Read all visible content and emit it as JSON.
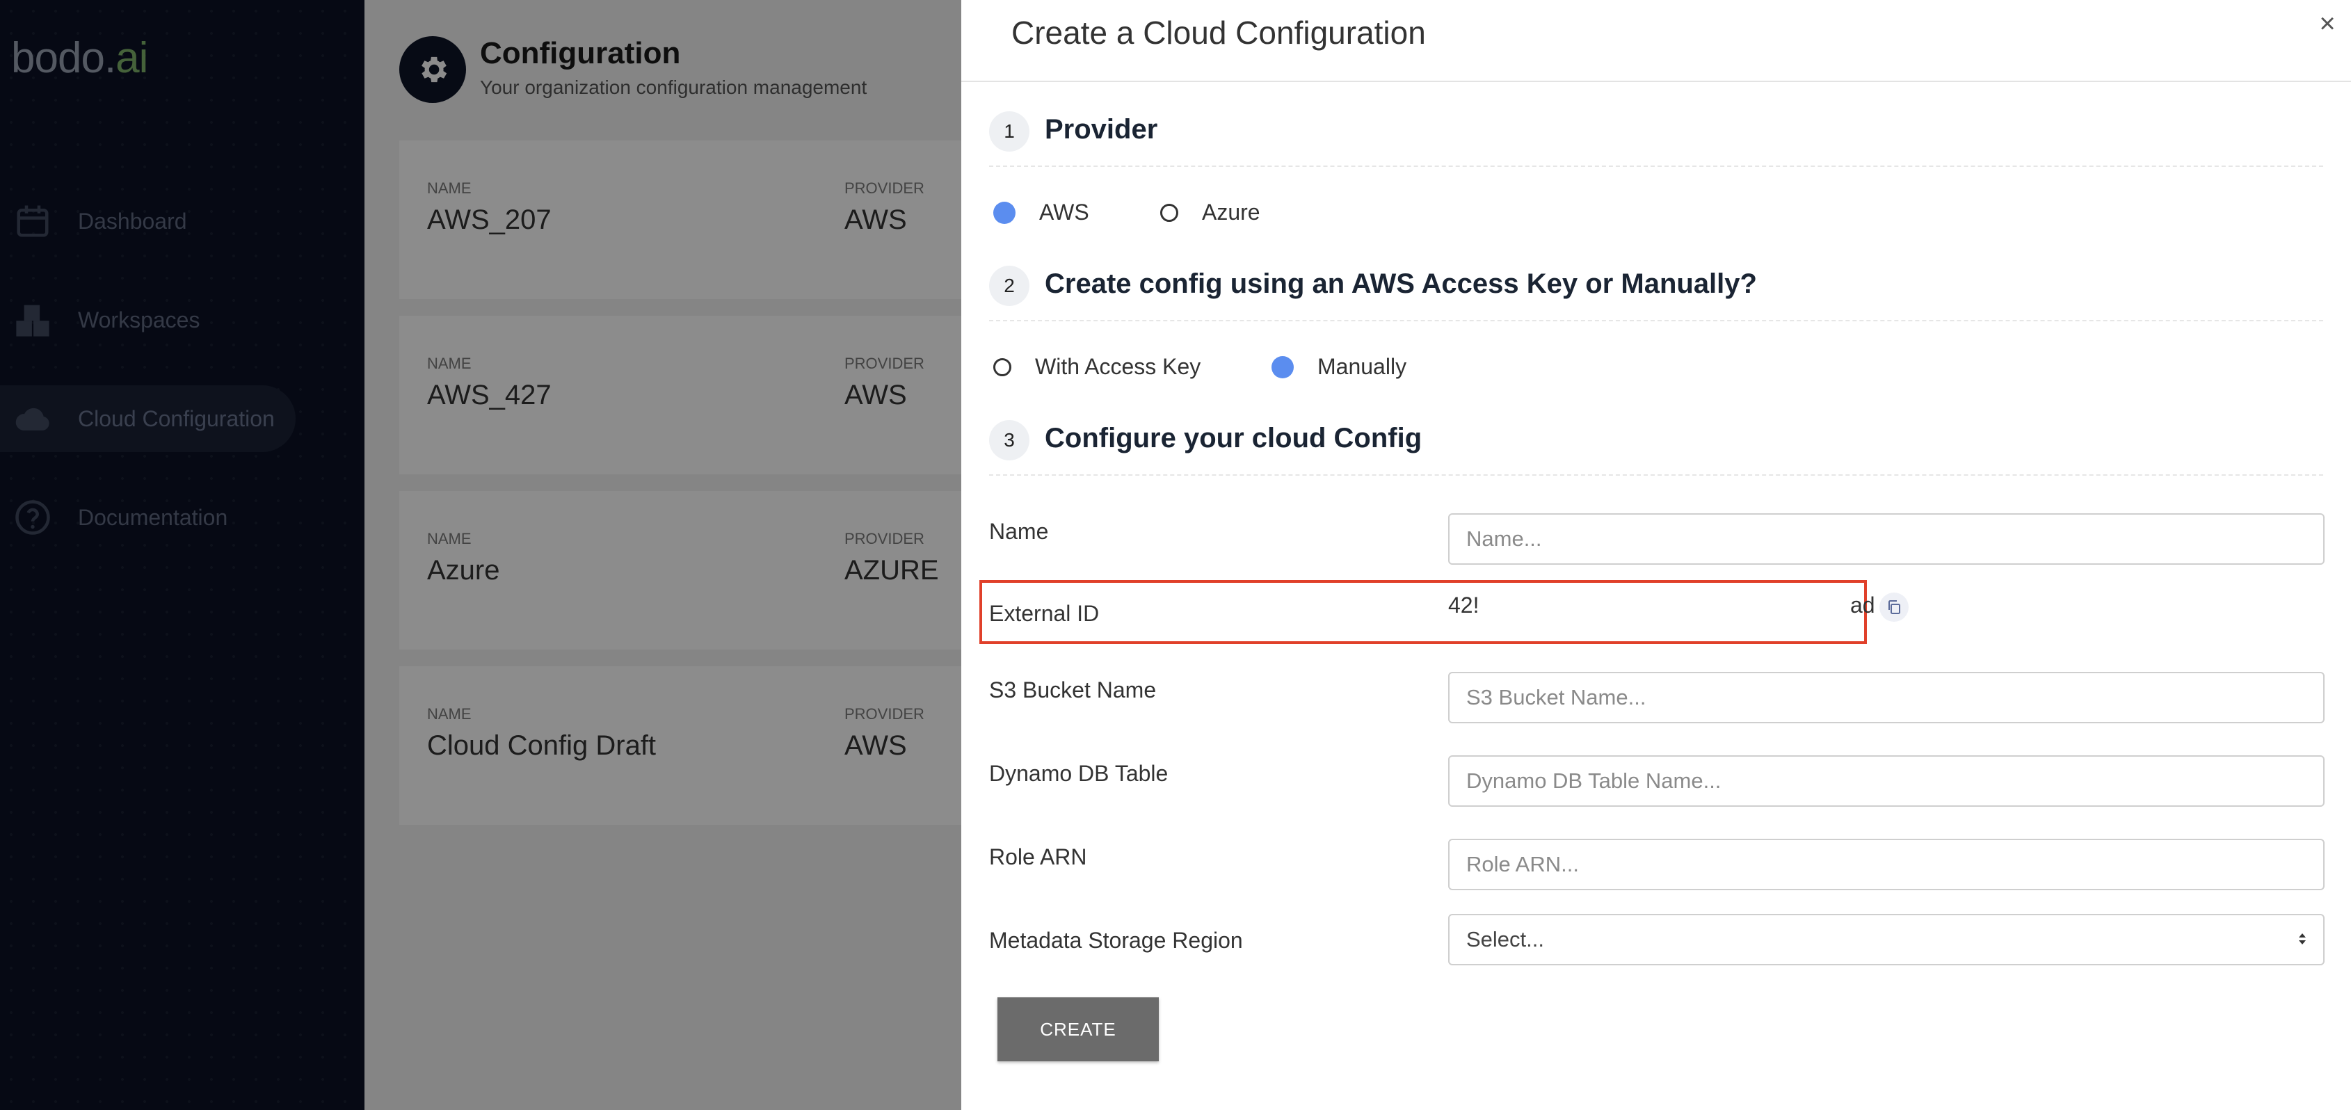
{
  "logo": {
    "main": "bodo",
    "dot": ".",
    "ai": "ai"
  },
  "sidebar": {
    "items": [
      {
        "label": "Dashboard",
        "icon": "calendar-icon"
      },
      {
        "label": "Workspaces",
        "icon": "boxes-icon"
      },
      {
        "label": "Cloud Configuration",
        "icon": "cloud-icon",
        "active": true
      },
      {
        "label": "Documentation",
        "icon": "help-circle-icon"
      }
    ]
  },
  "header": {
    "title": "Configuration",
    "subtitle": "Your organization configuration management",
    "icon": "gear-icon"
  },
  "cards": [
    {
      "name_label": "NAME",
      "name": "AWS_207",
      "provider_label": "PROVIDER",
      "provider": "AWS"
    },
    {
      "name_label": "NAME",
      "name": "AWS_427",
      "provider_label": "PROVIDER",
      "provider": "AWS"
    },
    {
      "name_label": "NAME",
      "name": "Azure",
      "provider_label": "PROVIDER",
      "provider": "AZURE"
    },
    {
      "name_label": "NAME",
      "name": "Cloud Config Draft",
      "provider_label": "PROVIDER",
      "provider": "AWS"
    }
  ],
  "drawer": {
    "title": "Create a Cloud Configuration",
    "close": "×",
    "steps": [
      {
        "num": "1",
        "title": "Provider"
      },
      {
        "num": "2",
        "title": "Create config using an AWS Access Key or Manually?"
      },
      {
        "num": "3",
        "title": "Configure your cloud Config"
      }
    ],
    "provider_options": [
      {
        "label": "AWS",
        "checked": true
      },
      {
        "label": "Azure",
        "checked": false
      }
    ],
    "method_options": [
      {
        "label": "With Access Key",
        "checked": false
      },
      {
        "label": "Manually",
        "checked": true
      }
    ],
    "form": {
      "name": {
        "label": "Name",
        "placeholder": "Name..."
      },
      "external_id": {
        "label": "External ID",
        "value_start": "42!",
        "value_end": "ad"
      },
      "s3": {
        "label": "S3 Bucket Name",
        "placeholder": "S3 Bucket Name..."
      },
      "dynamo": {
        "label": "Dynamo DB Table",
        "placeholder": "Dynamo DB Table Name..."
      },
      "role": {
        "label": "Role ARN",
        "placeholder": "Role ARN..."
      },
      "region": {
        "label": "Metadata Storage Region",
        "selected": "Select..."
      }
    },
    "create_label": "CREATE"
  },
  "colors": {
    "accent": "#5b8def",
    "sidebar_bg": "#0b1225",
    "highlight": "#e0402a"
  }
}
